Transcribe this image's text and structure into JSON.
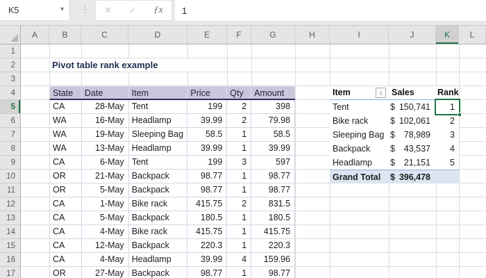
{
  "formula_bar": {
    "name_box": "K5",
    "formula": "1",
    "cancel_icon": "✕",
    "enter_icon": "✓",
    "fx_label": "ƒx",
    "dots": "⋮",
    "dropdown": "▾"
  },
  "columns": [
    "A",
    "B",
    "C",
    "D",
    "E",
    "F",
    "G",
    "H",
    "I",
    "J",
    "K",
    "L"
  ],
  "selected_cell": "K5",
  "row_numbers": [
    "1",
    "2",
    "3",
    "4",
    "5",
    "6",
    "7",
    "8",
    "9",
    "10",
    "11",
    "12",
    "13",
    "14",
    "15",
    "16",
    "17"
  ],
  "title": "Pivot table rank example",
  "main_table": {
    "headers": [
      "State",
      "Date",
      "Item",
      "Price",
      "Qty",
      "Amount"
    ],
    "rows": [
      [
        "CA",
        "28-May",
        "Tent",
        "199",
        "2",
        "398"
      ],
      [
        "WA",
        "16-May",
        "Headlamp",
        "39.99",
        "2",
        "79.98"
      ],
      [
        "WA",
        "19-May",
        "Sleeping Bag",
        "58.5",
        "1",
        "58.5"
      ],
      [
        "WA",
        "13-May",
        "Headlamp",
        "39.99",
        "1",
        "39.99"
      ],
      [
        "CA",
        "6-May",
        "Tent",
        "199",
        "3",
        "597"
      ],
      [
        "OR",
        "21-May",
        "Backpack",
        "98.77",
        "1",
        "98.77"
      ],
      [
        "OR",
        "5-May",
        "Backpack",
        "98.77",
        "1",
        "98.77"
      ],
      [
        "CA",
        "1-May",
        "Bike rack",
        "415.75",
        "2",
        "831.5"
      ],
      [
        "CA",
        "5-May",
        "Backpack",
        "180.5",
        "1",
        "180.5"
      ],
      [
        "CA",
        "4-May",
        "Bike rack",
        "415.75",
        "1",
        "415.75"
      ],
      [
        "CA",
        "12-May",
        "Backpack",
        "220.3",
        "1",
        "220.3"
      ],
      [
        "CA",
        "4-May",
        "Headlamp",
        "39.99",
        "4",
        "159.96"
      ],
      [
        "OR",
        "27-May",
        "Backpack",
        "98.77",
        "1",
        "98.77"
      ]
    ]
  },
  "pivot_table": {
    "headers": [
      "Item",
      "Sales",
      "Rank"
    ],
    "sort_icon": "↓",
    "currency": "$",
    "rows": [
      [
        "Tent",
        "150,741",
        "1"
      ],
      [
        "Bike rack",
        "102,061",
        "2"
      ],
      [
        "Sleeping Bag",
        "78,989",
        "3"
      ],
      [
        "Backpack",
        "43,537",
        "4"
      ],
      [
        "Headlamp",
        "21,151",
        "5"
      ]
    ],
    "grand_total_label": "Grand Total",
    "grand_total_value": "396,478"
  },
  "colors": {
    "excel_green": "#217346",
    "table_header_fill": "#ccc6dd",
    "table_header_border": "#322d5c",
    "table_gridline": "#d8d4e5",
    "pivot_total_fill": "#dbe5f1",
    "pivot_border": "#8eaadb",
    "sheet_gridline": "#dcdcdc",
    "header_gray": "#e5e5e5"
  }
}
